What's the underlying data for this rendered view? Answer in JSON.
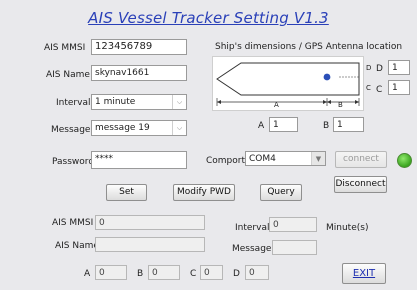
{
  "title": "AIS Vessel Tracker Setting  V1.3",
  "settings": {
    "mmsi_label": "AIS MMSI",
    "mmsi_value": "123456789",
    "name_label": "AIS Name",
    "name_value": "skynav1661",
    "interval_label": "Interval",
    "interval_value": "1 minute",
    "message_label": "Message",
    "message_value": "message 19",
    "password_label": "Password",
    "password_value": "****"
  },
  "dimensions": {
    "title": "Ship's dimensions / GPS Antenna location",
    "a_label": "A",
    "a_value": "1",
    "b_label": "B",
    "b_value": "1",
    "c_label": "C",
    "c_value": "1",
    "d_label": "D",
    "d_value": "1",
    "diagram_a": "A",
    "diagram_b": "B",
    "diagram_c": "C",
    "diagram_d": "D"
  },
  "comport": {
    "label": "Comport",
    "value": "COM4",
    "connect_label": "connect",
    "disconnect_label": "Disconnect",
    "status_color": "#3aa51f"
  },
  "actions": {
    "set_label": "Set",
    "modify_pwd_label": "Modify PWD",
    "query_label": "Query"
  },
  "readout": {
    "mmsi_label": "AIS MMSI",
    "mmsi_value": "0",
    "name_label": "AIS Name",
    "name_value": "",
    "interval_label": "Interval",
    "interval_value": "0",
    "interval_unit": "Minute(s)",
    "message_label": "Message",
    "message_value": "",
    "a_label": "A",
    "a_value": "0",
    "b_label": "B",
    "b_value": "0",
    "c_label": "C",
    "c_value": "0",
    "d_label": "D",
    "d_value": "0"
  },
  "exit_label": "EXIT",
  "colors": {
    "title": "#2a40b8",
    "background": "#e9e9ec",
    "antenna": "#2a4fb8"
  }
}
